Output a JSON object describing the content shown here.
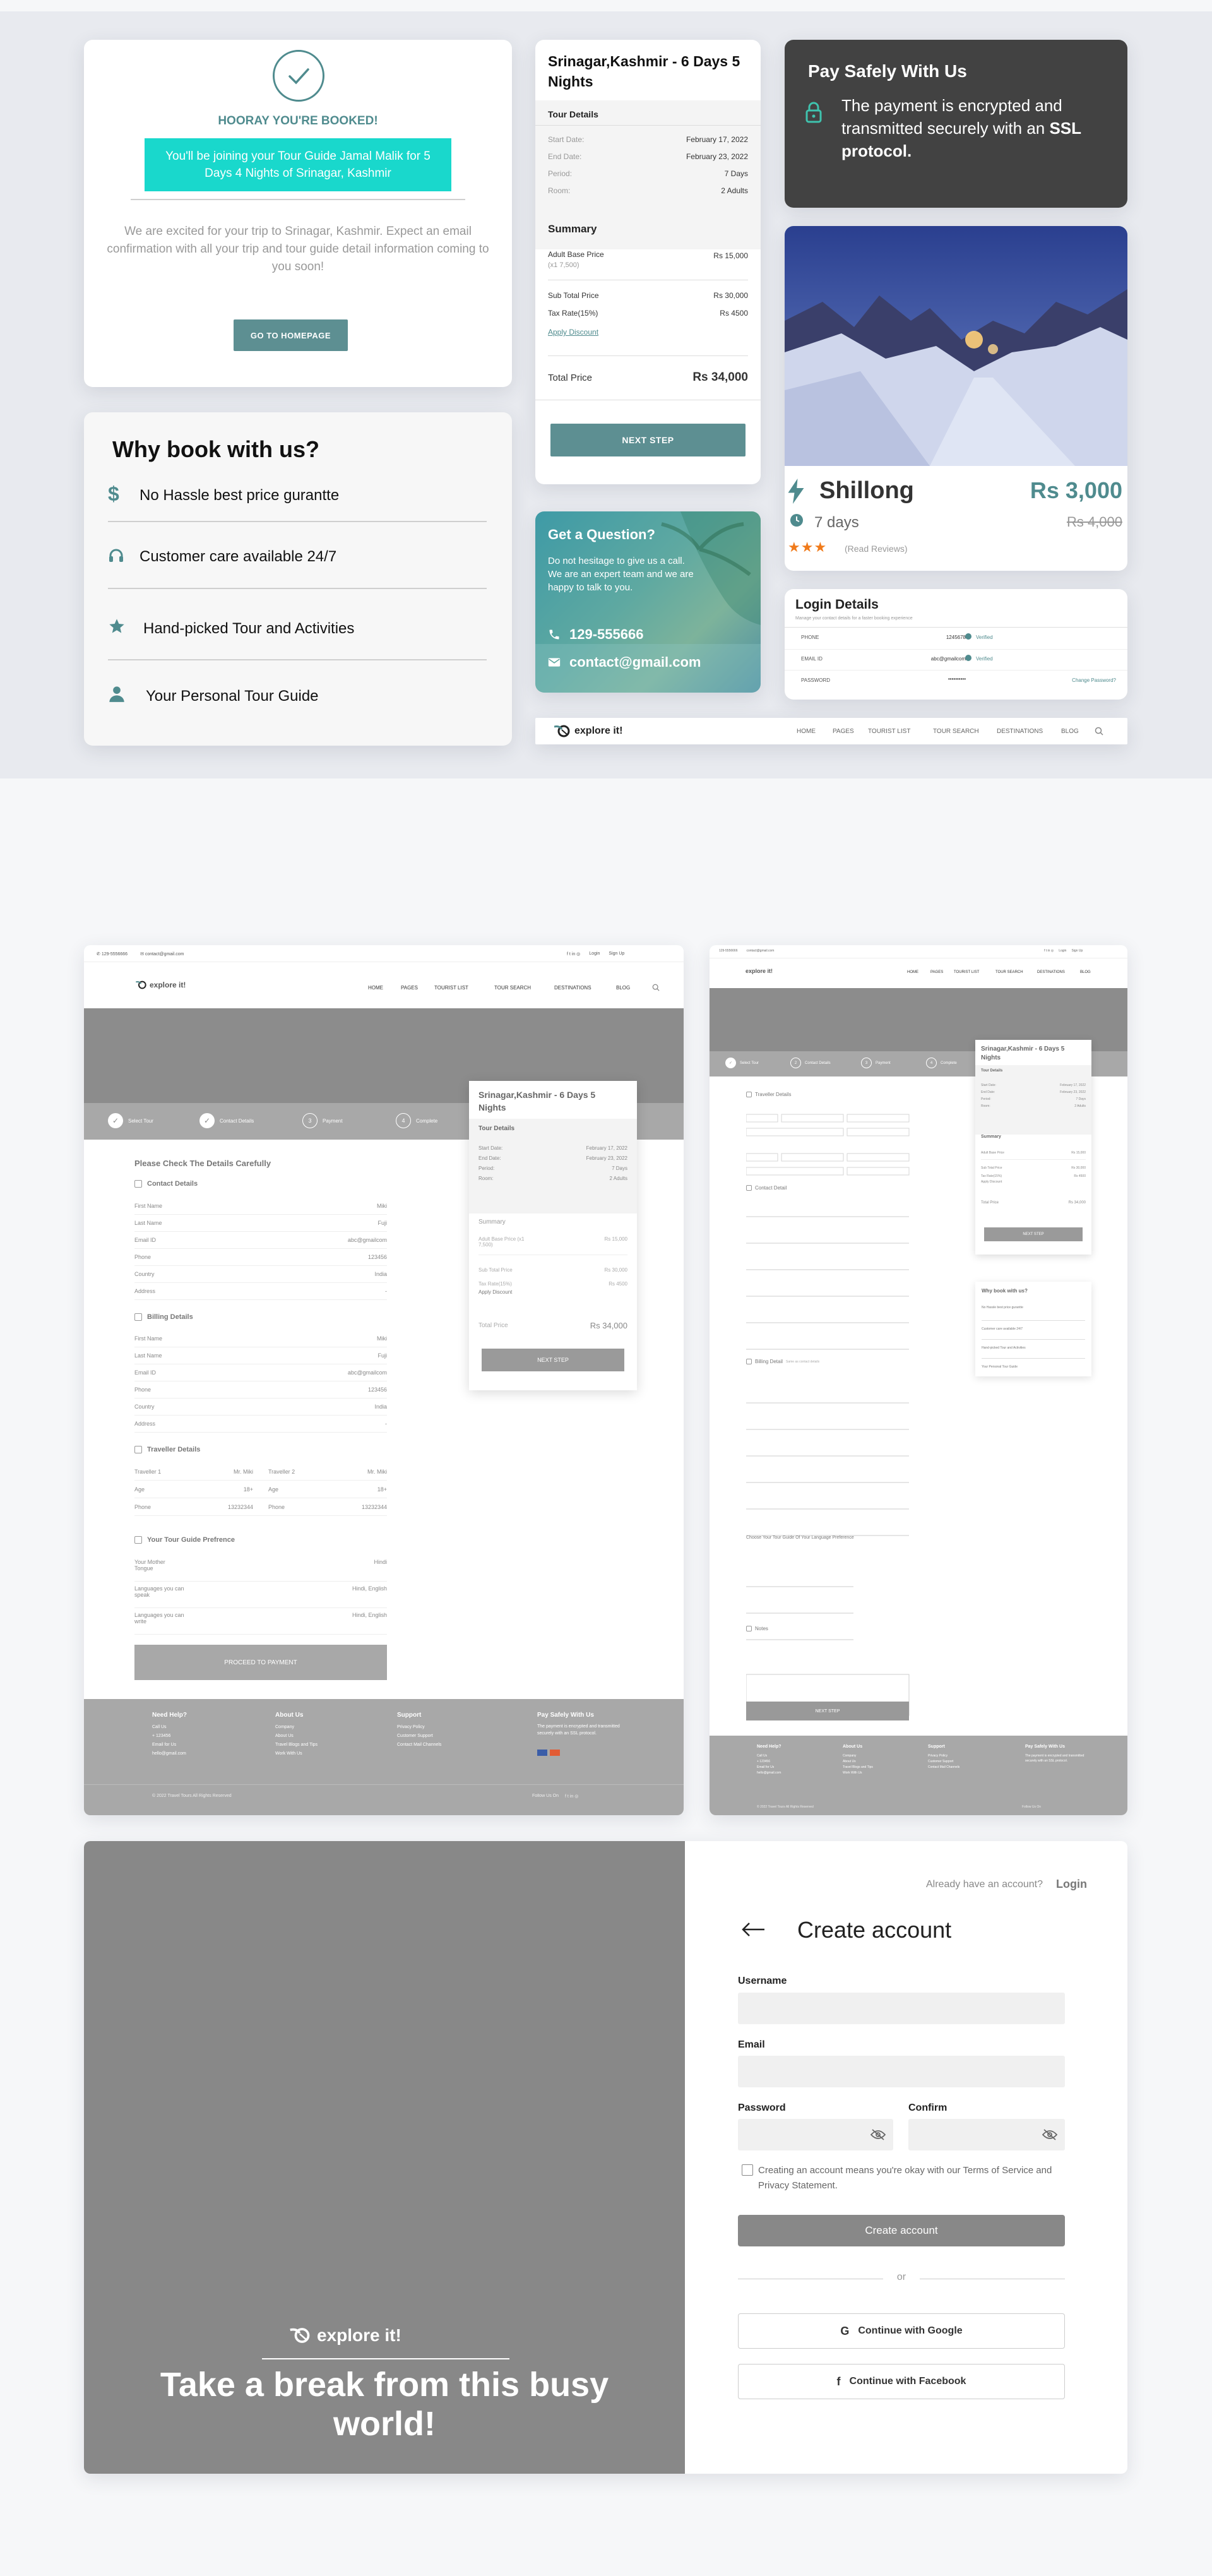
{
  "booked": {
    "title": "HOORAY YOU'RE BOOKED!",
    "banner": "You'll be joining your Tour Guide Jamal Malik for 5 Days 4 Nights of Srinagar, Kashmir",
    "message": "We are excited for your trip to Srinagar, Kashmir. Expect an email confirmation with all your trip and tour guide detail information coming to you soon!",
    "button": "GO TO HOMEPAGE"
  },
  "why": {
    "title": "Why book with us?",
    "items": [
      {
        "icon": "dollar-icon",
        "label": "No Hassle best price gurantte"
      },
      {
        "icon": "headphones-icon",
        "label": "Customer care available 24/7"
      },
      {
        "icon": "star-icon",
        "label": "Hand-picked Tour and Activities"
      },
      {
        "icon": "person-icon",
        "label": "Your Personal Tour Guide"
      }
    ]
  },
  "summary": {
    "title": "Srinagar,Kashmir - 6 Days 5 Nights",
    "details_heading": "Tour Details",
    "details": [
      {
        "label": "Start Date:",
        "value": "February 17, 2022"
      },
      {
        "label": "End Date:",
        "value": "February 23, 2022"
      },
      {
        "label": "Period:",
        "value": "7 Days"
      },
      {
        "label": "Room:",
        "value": "2 Adults"
      }
    ],
    "summary_heading": "Summary",
    "adult_label": "Adult Base Price",
    "adult_sub": "(x1 7,500)",
    "adult_value": "Rs 15,000",
    "subtotal_label": "Sub Total Price",
    "subtotal_value": "Rs 30,000",
    "tax_label": "Tax Rate(15%)",
    "tax_value": "Rs 4500",
    "discount": "Apply Discount",
    "total_label": "Total Price",
    "total_value": "Rs 34,000",
    "button": "NEXT STEP"
  },
  "question": {
    "title": "Get a Question?",
    "text": "Do not hesitage to give us a call. We are an expert team and we are happy to talk to you.",
    "phone": "129-555666",
    "email": "contact@gmail.com"
  },
  "secure": {
    "title": "Pay Safely With Us",
    "text_a": "The payment is encrypted and transmitted securely with an ",
    "text_b": "SSL protocol."
  },
  "destination": {
    "name": "Shillong",
    "price": "Rs 3,000",
    "duration": "7 days",
    "old_price": "Rs 4,000",
    "reviews": "(Read Reviews)"
  },
  "login": {
    "title": "Login Details",
    "subtitle": "Manage your contact details for a faster booking experience",
    "rows": [
      {
        "label": "PHONE",
        "value": "1245678",
        "action": "Verified"
      },
      {
        "label": "EMAIL ID",
        "value": "abc@gmailcom",
        "action": "Verified"
      },
      {
        "label": "PASSWORD",
        "value": "••••••••••",
        "action": "Change Password?"
      }
    ]
  },
  "nav": {
    "logo": "explore it!",
    "links": [
      "HOME",
      "PAGES",
      "TOURIST LIST",
      "TOUR SEARCH",
      "DESTINATIONS",
      "BLOG"
    ]
  },
  "checkout": {
    "topbar_phone": "129-5556666",
    "topbar_email": "contact@gmail.com",
    "login": "Login",
    "signup": "Sign Up",
    "steps": [
      "Select Tour",
      "Contact Details",
      "Payment",
      "Complete"
    ],
    "step_numbers": [
      "3",
      "4"
    ],
    "heading": "Please Check The Details Carefully",
    "contact_title": "Contact Details",
    "contact_rows": [
      {
        "label": "First Name",
        "value": "Miki"
      },
      {
        "label": "Last Name",
        "value": "Fuji"
      },
      {
        "label": "Email ID",
        "value": "abc@gmailcom"
      },
      {
        "label": "Phone",
        "value": "123456"
      },
      {
        "label": "Country",
        "value": "India"
      },
      {
        "label": "Address",
        "value": "-"
      }
    ],
    "billing_title": "Billing Details",
    "billing_rows": [
      {
        "label": "First Name",
        "value": "Miki"
      },
      {
        "label": "Last Name",
        "value": "Fuji"
      },
      {
        "label": "Email ID",
        "value": "abc@gmailcom"
      },
      {
        "label": "Phone",
        "value": "123456"
      },
      {
        "label": "Country",
        "value": "India"
      },
      {
        "label": "Address",
        "value": "-"
      }
    ],
    "traveller_title": "Traveller Details",
    "traveller1_label": "Traveller 1",
    "traveller1_value": "Mr. Miki",
    "traveller2_label": "Traveller 2",
    "traveller2_value": "Mr. Miki",
    "age_label": "Age",
    "age_value": "18+",
    "phone_label": "Phone",
    "phone_value": "13232344",
    "guide_title": "Your Tour Guide Prefrence",
    "guide_rows": [
      {
        "label": "Your Mother Tongue",
        "value": "Hindi"
      },
      {
        "label": "Languages you can speak",
        "value": "Hindi, English"
      },
      {
        "label": "Languages you can write",
        "value": "Hindi, English"
      }
    ],
    "proceed": "PROCEED TO PAYMENT",
    "footer": {
      "help_title": "Need Help?",
      "help_lines": [
        "Call Us",
        "+ 123456",
        "Email for Us",
        "hello@gmail.com"
      ],
      "about_title": "About Us",
      "about_lines": [
        "Company",
        "About Us",
        "Travel Blogs and Tips",
        "Work With Us"
      ],
      "support_title": "Support",
      "support_lines": [
        "Privacy Policy",
        "Customer Support",
        "Contact Mail Channels"
      ],
      "pay_title": "Pay Safely With Us",
      "pay_text": "The payment is encrypted and transmitted securely with an SSL protocol.",
      "copyright": "© 2022 Travel Tours All Rights Reserved",
      "follow": "Follow Us On"
    }
  },
  "form_page": {
    "section_traveller": "Traveller Details",
    "section_contact": "Contact Detail",
    "section_billing": "Billing Detail",
    "billing_note": "Same as contact details",
    "section_language": "Choose Your Tour Guide Of Your Language Preference",
    "section_notes": "Notes",
    "next": "NEXT STEP",
    "why_title": "Why book with us?"
  },
  "signup": {
    "logo": "explore it!",
    "tagline": "Take a break from this busy world!",
    "already": "Already have an account?",
    "login": "Login",
    "title": "Create account",
    "username": "Username",
    "email": "Email",
    "password": "Password",
    "confirm": "Confirm",
    "terms": "Creating an account means you're okay with our Terms of Service and Privacy Statement.",
    "create": "Create account",
    "or": "or",
    "google": "Continue with Google",
    "facebook": "Continue with Facebook"
  }
}
